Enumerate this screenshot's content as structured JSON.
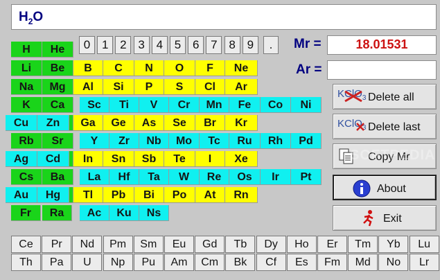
{
  "formula": {
    "prefix": "H",
    "subscript": "2",
    "suffix": "O"
  },
  "digits": [
    "0",
    "1",
    "2",
    "3",
    "4",
    "5",
    "6",
    "7",
    "8",
    "9",
    "."
  ],
  "mr": {
    "label": "Mr =",
    "value": "18.01531"
  },
  "ar": {
    "label": "Ar =",
    "value": ""
  },
  "buttons": {
    "delete_all": {
      "label": "Delete all",
      "icon_text": "KClO",
      "icon_sub": "3"
    },
    "delete_last": {
      "label": "Delete last",
      "icon_text": "KClO",
      "icon_sub": "3"
    },
    "copy_mr": {
      "label": "Copy Mr"
    },
    "about": {
      "label": "About"
    },
    "exit": {
      "label": "Exit"
    }
  },
  "watermark": "SOFTPEDIA",
  "periodic_rows": [
    [
      "H",
      "He"
    ],
    [
      "Li",
      "Be",
      "B",
      "C",
      "N",
      "O",
      "F",
      "Ne"
    ],
    [
      "Na",
      "Mg",
      "Al",
      "Si",
      "P",
      "S",
      "Cl",
      "Ar"
    ],
    [
      "K",
      "Ca",
      "Sc",
      "Ti",
      "V",
      "Cr",
      "Mn",
      "Fe",
      "Co",
      "Ni"
    ],
    [
      "Cu",
      "Zn",
      "Ga",
      "Ge",
      "As",
      "Se",
      "Br",
      "Kr"
    ],
    [
      "Rb",
      "Sr",
      "Y",
      "Zr",
      "Nb",
      "Mo",
      "Tc",
      "Ru",
      "Rh",
      "Pd"
    ],
    [
      "Ag",
      "Cd",
      "In",
      "Sn",
      "Sb",
      "Te",
      "I",
      "Xe"
    ],
    [
      "Cs",
      "Ba",
      "La",
      "Hf",
      "Ta",
      "W",
      "Re",
      "Os",
      "Ir",
      "Pt"
    ],
    [
      "Au",
      "Hg",
      "Tl",
      "Pb",
      "Bi",
      "Po",
      "At",
      "Rn"
    ],
    [
      "Fr",
      "Ra",
      "Ac",
      "Ku",
      "Ns"
    ]
  ],
  "lanthanides": [
    "Ce",
    "Pr",
    "Nd",
    "Pm",
    "Sm",
    "Eu",
    "Gd",
    "Tb",
    "Dy",
    "Ho",
    "Er",
    "Tm",
    "Yb",
    "Lu"
  ],
  "actinides": [
    "Th",
    "Pa",
    "U",
    "Np",
    "Pu",
    "Am",
    "Cm",
    "Bk",
    "Cf",
    "Es",
    "Fm",
    "Md",
    "No",
    "Lr"
  ],
  "colors": {
    "s_block": "#1ad41a",
    "p_block": "#ffff00",
    "d_block": "#10f0f0",
    "mr_value": "#cc1111",
    "label": "#000080"
  }
}
